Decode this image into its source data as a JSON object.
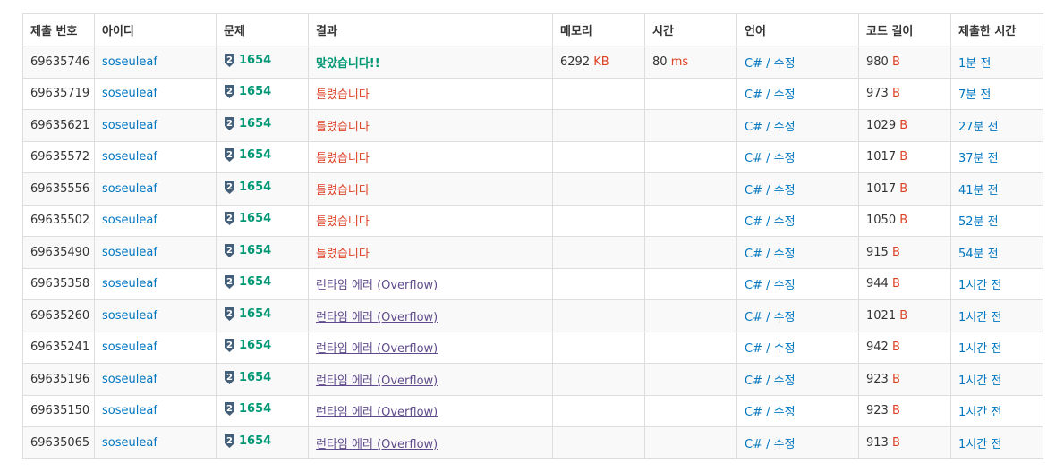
{
  "headers": [
    "제출 번호",
    "아이디",
    "문제",
    "결과",
    "메모리",
    "시간",
    "언어",
    "코드 길이",
    "제출한 시간"
  ],
  "colors": {
    "link": "#0076c0",
    "accepted": "#009874",
    "wrong": "#dd4124",
    "runtime_error": "#5f4b8b",
    "unit": "#dd4124",
    "tier_badge": "#435f7a"
  },
  "tier_icon": "silver-2-tier-icon",
  "tier_label": "2",
  "rows": [
    {
      "id": "69635746",
      "user": "soseuleaf",
      "problem": "1654",
      "result": "맞았습니다!!",
      "result_type": "ac",
      "memory": "6292",
      "memory_unit": "KB",
      "time": "80",
      "time_unit": "ms",
      "lang": "C#",
      "edit": "수정",
      "length": "980",
      "length_unit": "B",
      "submitted": "1분 전"
    },
    {
      "id": "69635719",
      "user": "soseuleaf",
      "problem": "1654",
      "result": "틀렸습니다",
      "result_type": "wa",
      "memory": "",
      "memory_unit": "",
      "time": "",
      "time_unit": "",
      "lang": "C#",
      "edit": "수정",
      "length": "973",
      "length_unit": "B",
      "submitted": "7분 전"
    },
    {
      "id": "69635621",
      "user": "soseuleaf",
      "problem": "1654",
      "result": "틀렸습니다",
      "result_type": "wa",
      "memory": "",
      "memory_unit": "",
      "time": "",
      "time_unit": "",
      "lang": "C#",
      "edit": "수정",
      "length": "1029",
      "length_unit": "B",
      "submitted": "27분 전"
    },
    {
      "id": "69635572",
      "user": "soseuleaf",
      "problem": "1654",
      "result": "틀렸습니다",
      "result_type": "wa",
      "memory": "",
      "memory_unit": "",
      "time": "",
      "time_unit": "",
      "lang": "C#",
      "edit": "수정",
      "length": "1017",
      "length_unit": "B",
      "submitted": "37분 전"
    },
    {
      "id": "69635556",
      "user": "soseuleaf",
      "problem": "1654",
      "result": "틀렸습니다",
      "result_type": "wa",
      "memory": "",
      "memory_unit": "",
      "time": "",
      "time_unit": "",
      "lang": "C#",
      "edit": "수정",
      "length": "1017",
      "length_unit": "B",
      "submitted": "41분 전"
    },
    {
      "id": "69635502",
      "user": "soseuleaf",
      "problem": "1654",
      "result": "틀렸습니다",
      "result_type": "wa",
      "memory": "",
      "memory_unit": "",
      "time": "",
      "time_unit": "",
      "lang": "C#",
      "edit": "수정",
      "length": "1050",
      "length_unit": "B",
      "submitted": "52분 전"
    },
    {
      "id": "69635490",
      "user": "soseuleaf",
      "problem": "1654",
      "result": "틀렸습니다",
      "result_type": "wa",
      "memory": "",
      "memory_unit": "",
      "time": "",
      "time_unit": "",
      "lang": "C#",
      "edit": "수정",
      "length": "915",
      "length_unit": "B",
      "submitted": "54분 전"
    },
    {
      "id": "69635358",
      "user": "soseuleaf",
      "problem": "1654",
      "result": "런타임 에러 (Overflow)",
      "result_type": "rte",
      "memory": "",
      "memory_unit": "",
      "time": "",
      "time_unit": "",
      "lang": "C#",
      "edit": "수정",
      "length": "944",
      "length_unit": "B",
      "submitted": "1시간 전"
    },
    {
      "id": "69635260",
      "user": "soseuleaf",
      "problem": "1654",
      "result": "런타임 에러 (Overflow)",
      "result_type": "rte",
      "memory": "",
      "memory_unit": "",
      "time": "",
      "time_unit": "",
      "lang": "C#",
      "edit": "수정",
      "length": "1021",
      "length_unit": "B",
      "submitted": "1시간 전"
    },
    {
      "id": "69635241",
      "user": "soseuleaf",
      "problem": "1654",
      "result": "런타임 에러 (Overflow)",
      "result_type": "rte",
      "memory": "",
      "memory_unit": "",
      "time": "",
      "time_unit": "",
      "lang": "C#",
      "edit": "수정",
      "length": "942",
      "length_unit": "B",
      "submitted": "1시간 전"
    },
    {
      "id": "69635196",
      "user": "soseuleaf",
      "problem": "1654",
      "result": "런타임 에러 (Overflow)",
      "result_type": "rte",
      "memory": "",
      "memory_unit": "",
      "time": "",
      "time_unit": "",
      "lang": "C#",
      "edit": "수정",
      "length": "923",
      "length_unit": "B",
      "submitted": "1시간 전"
    },
    {
      "id": "69635150",
      "user": "soseuleaf",
      "problem": "1654",
      "result": "런타임 에러 (Overflow)",
      "result_type": "rte",
      "memory": "",
      "memory_unit": "",
      "time": "",
      "time_unit": "",
      "lang": "C#",
      "edit": "수정",
      "length": "923",
      "length_unit": "B",
      "submitted": "1시간 전"
    },
    {
      "id": "69635065",
      "user": "soseuleaf",
      "problem": "1654",
      "result": "런타임 에러 (Overflow)",
      "result_type": "rte",
      "memory": "",
      "memory_unit": "",
      "time": "",
      "time_unit": "",
      "lang": "C#",
      "edit": "수정",
      "length": "913",
      "length_unit": "B",
      "submitted": "1시간 전"
    }
  ]
}
